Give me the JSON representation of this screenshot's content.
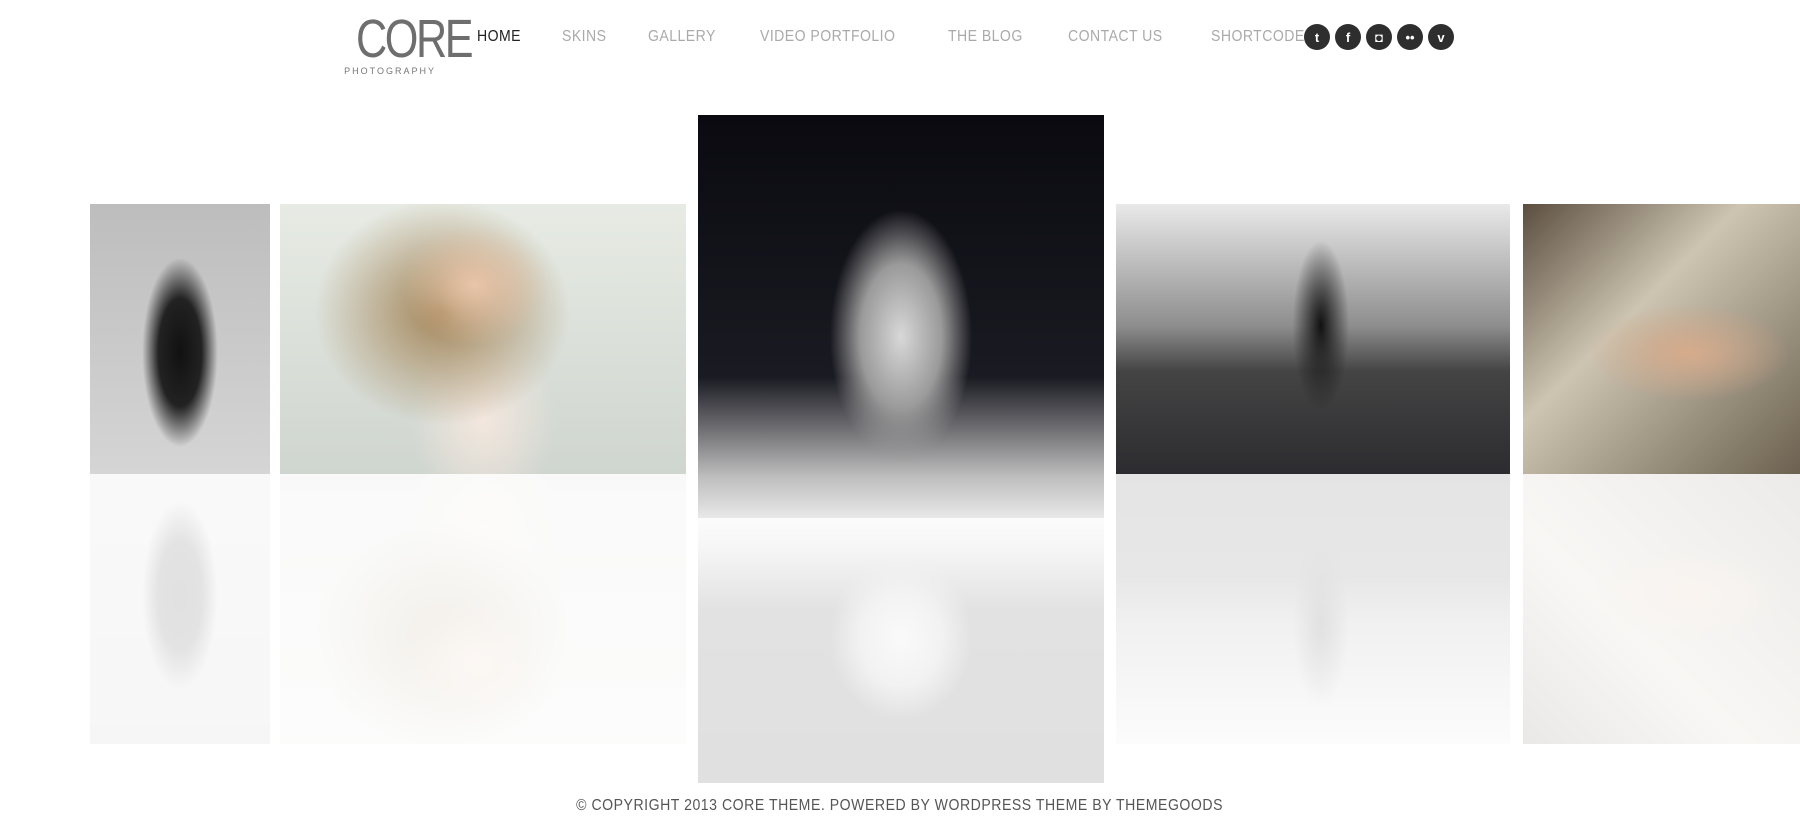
{
  "logo": {
    "title": "CORE",
    "subtitle": "PHOTOGRAPHY"
  },
  "nav": [
    {
      "label": "HOME",
      "active": true
    },
    {
      "label": "SKINS"
    },
    {
      "label": "GALLERY"
    },
    {
      "label": "VIDEO PORTFOLIO"
    },
    {
      "label": "THE BLOG"
    },
    {
      "label": "CONTACT US"
    },
    {
      "label": "SHORTCODES"
    }
  ],
  "social": [
    {
      "icon": "twitter-icon",
      "glyph": "t"
    },
    {
      "icon": "facebook-icon",
      "glyph": "f"
    },
    {
      "icon": "instagram-icon",
      "glyph": "◘"
    },
    {
      "icon": "flickr-icon",
      "glyph": "••"
    },
    {
      "icon": "vimeo-icon",
      "glyph": "v"
    }
  ],
  "footer": {
    "text": "© COPYRIGHT 2013 CORE THEME. POWERED BY WORDPRESS THEME BY THEMEGOODS"
  }
}
